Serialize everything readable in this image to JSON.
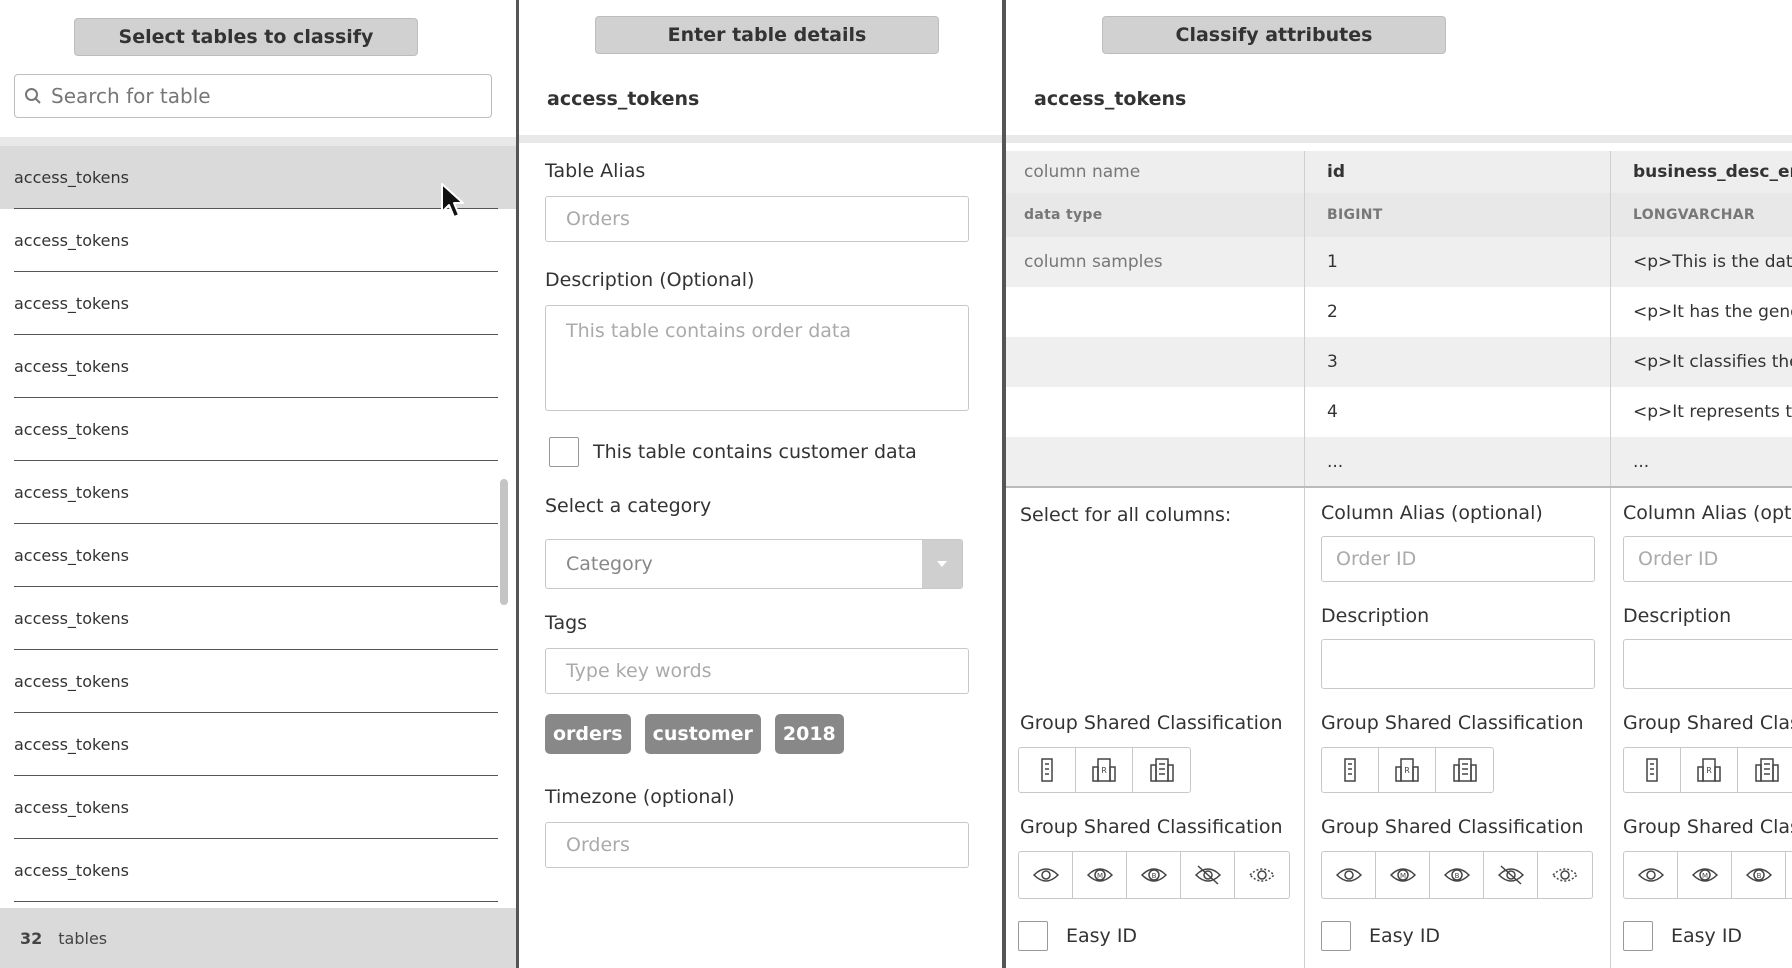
{
  "left": {
    "header": "Select tables to classify",
    "search_placeholder": "Search for table",
    "tables": [
      "access_tokens",
      "access_tokens",
      "access_tokens",
      "access_tokens",
      "access_tokens",
      "access_tokens",
      "access_tokens",
      "access_tokens",
      "access_tokens",
      "access_tokens",
      "access_tokens",
      "access_tokens"
    ],
    "footer": {
      "count": "32",
      "label": "tables"
    }
  },
  "middle": {
    "header": "Enter table details",
    "table_name": "access_tokens",
    "alias_label": "Table Alias",
    "alias_placeholder": "Orders",
    "description_label": "Description (Optional)",
    "description_placeholder": "This table contains order data",
    "customer_checkbox_label": "This table contains customer data",
    "category_label": "Select a category",
    "category_value": "Category",
    "tags_label": "Tags",
    "tags_placeholder": "Type key words",
    "tags": [
      "orders",
      "customer",
      "2018"
    ],
    "timezone_label": "Timezone (optional)",
    "timezone_placeholder": "Orders"
  },
  "right": {
    "header": "Classify attributes",
    "table_name": "access_tokens",
    "row_labels": {
      "column_name": "column name",
      "data_type": "data type",
      "column_samples": "column samples"
    },
    "columns": [
      {
        "name": "id",
        "type": "BIGINT",
        "samples": [
          "1",
          "2",
          "3",
          "4",
          "..."
        ]
      },
      {
        "name": "business_desc_en",
        "type": "LONGVARCHAR",
        "samples": [
          "<p>This is the date",
          "<p>It has the gende",
          "<p>It classifies the",
          "<p>It represents th",
          "..."
        ]
      }
    ],
    "all_columns_label": "Select for all columns:",
    "column_alias_label": "Column Alias (optional)",
    "column_alias_placeholder": "Order ID",
    "description_label": "Description",
    "group_shared_label": "Group Shared Classification",
    "easy_id_label": "Easy ID"
  }
}
